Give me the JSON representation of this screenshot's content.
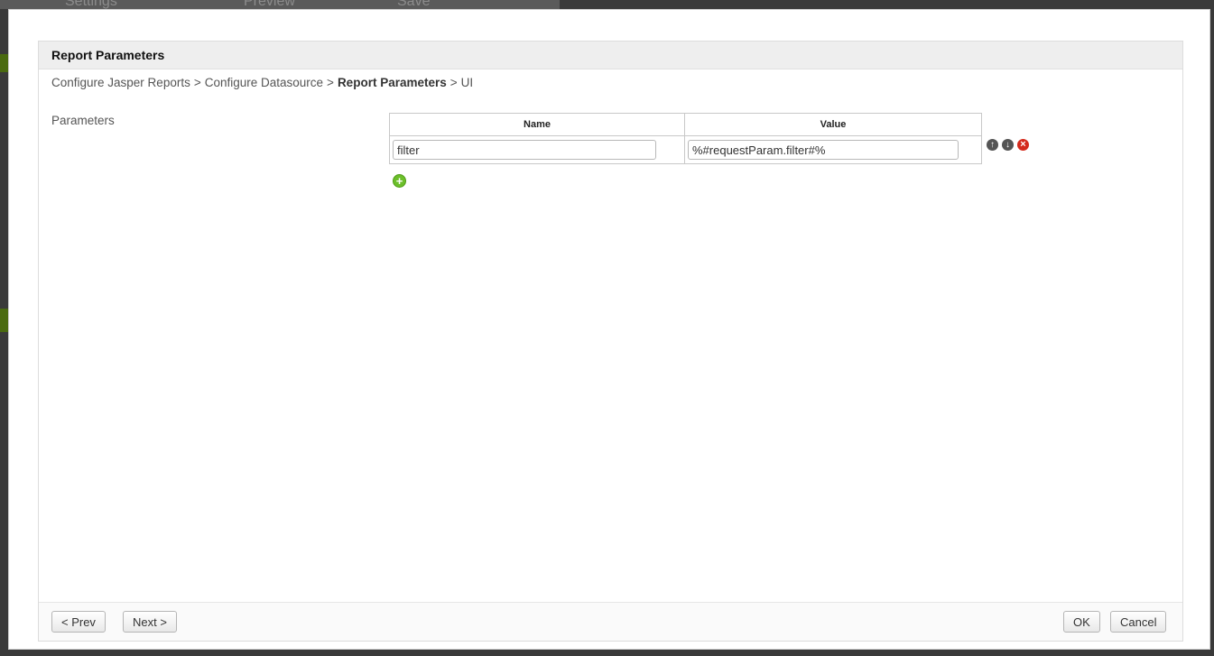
{
  "background_app": {
    "tabs": [
      "Settings",
      "Preview",
      "Save"
    ]
  },
  "panel": {
    "title": "Report Parameters"
  },
  "breadcrumb": {
    "items": [
      "Configure Jasper Reports",
      "Configure Datasource",
      "Report Parameters",
      "UI"
    ],
    "separator": ">"
  },
  "parameters": {
    "label": "Parameters",
    "columns": [
      "Name",
      "Value"
    ],
    "rows": [
      {
        "name": "filter",
        "value": "%#requestParam.filter#%"
      }
    ],
    "row_actions": [
      "move-up-icon",
      "move-down-icon",
      "remove-icon"
    ],
    "add_icon": "add-icon"
  },
  "footer": {
    "prev_label": "< Prev",
    "next_label": "Next >",
    "ok_label": "OK",
    "cancel_label": "Cancel"
  },
  "colors": {
    "header_bg": "#eeeeee",
    "add_green": "#6cbf2a",
    "remove_red": "#d42a1c",
    "icon_gray": "#555555"
  }
}
